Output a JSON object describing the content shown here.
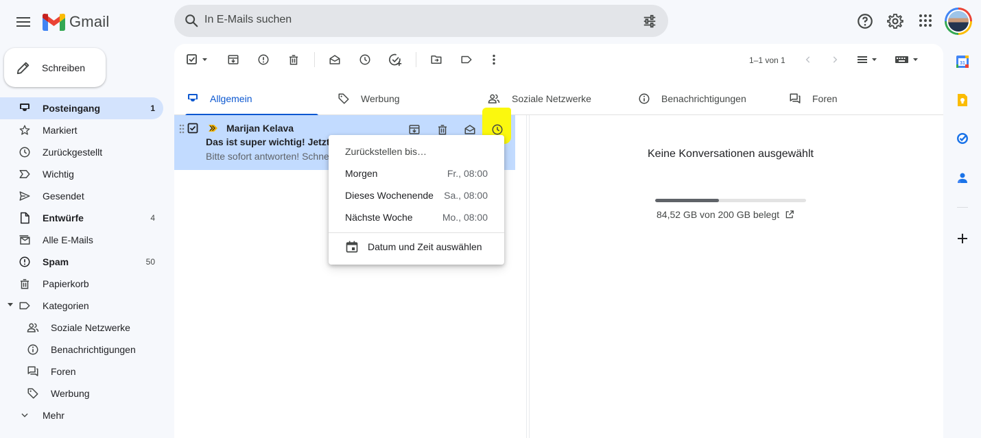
{
  "header": {
    "logo_text": "Gmail",
    "search_placeholder": "In E-Mails suchen"
  },
  "compose": {
    "label": "Schreiben"
  },
  "sidebar": {
    "items": [
      {
        "label": "Posteingang",
        "count": "1",
        "icon": "inbox-icon"
      },
      {
        "label": "Markiert",
        "count": "",
        "icon": "star-icon"
      },
      {
        "label": "Zurückgestellt",
        "count": "",
        "icon": "clock-icon"
      },
      {
        "label": "Wichtig",
        "count": "",
        "icon": "important-icon"
      },
      {
        "label": "Gesendet",
        "count": "",
        "icon": "send-icon"
      },
      {
        "label": "Entwürfe",
        "count": "4",
        "icon": "draft-icon"
      },
      {
        "label": "Alle E-Mails",
        "count": "",
        "icon": "all-mail-icon"
      },
      {
        "label": "Spam",
        "count": "50",
        "icon": "spam-icon"
      },
      {
        "label": "Papierkorb",
        "count": "",
        "icon": "trash-icon"
      },
      {
        "label": "Kategorien",
        "count": "",
        "icon": "label-icon"
      },
      {
        "label": "Soziale Netzwerke",
        "count": "",
        "icon": "people-icon"
      },
      {
        "label": "Benachrichtigungen",
        "count": "",
        "icon": "info-icon"
      },
      {
        "label": "Foren",
        "count": "",
        "icon": "forum-icon"
      },
      {
        "label": "Werbung",
        "count": "",
        "icon": "tag-icon"
      },
      {
        "label": "Mehr",
        "count": "",
        "icon": "chevron-down-icon"
      }
    ]
  },
  "toolbar": {
    "pagination": "1–1 von 1"
  },
  "tabs": [
    {
      "label": "Allgemein",
      "active": true
    },
    {
      "label": "Werbung",
      "active": false
    },
    {
      "label": "Soziale Netzwerke",
      "active": false
    },
    {
      "label": "Benachrichtigungen",
      "active": false
    },
    {
      "label": "Foren",
      "active": false
    }
  ],
  "email": {
    "sender": "Marijan Kelava",
    "subject": "Das ist super wichtig! Jetzt",
    "snippet": "Bitte sofort antworten! Schnell"
  },
  "reading_pane": {
    "empty_text": "Keine Konversationen ausgewählt",
    "storage_text": "84,52 GB von 200 GB belegt",
    "storage_used_fraction": 0.4226
  },
  "snooze_menu": {
    "title": "Zurückstellen bis…",
    "options": [
      {
        "label": "Morgen",
        "time": "Fr., 08:00"
      },
      {
        "label": "Dieses Wochenende",
        "time": "Sa., 08:00"
      },
      {
        "label": "Nächste Woche",
        "time": "Mo., 08:00"
      }
    ],
    "custom_label": "Datum und Zeit auswählen"
  },
  "colors": {
    "accent": "#0b57d0",
    "selected_row": "#c2dbff",
    "highlight": "#fbf80e",
    "nav_active": "#d3e3fd"
  }
}
